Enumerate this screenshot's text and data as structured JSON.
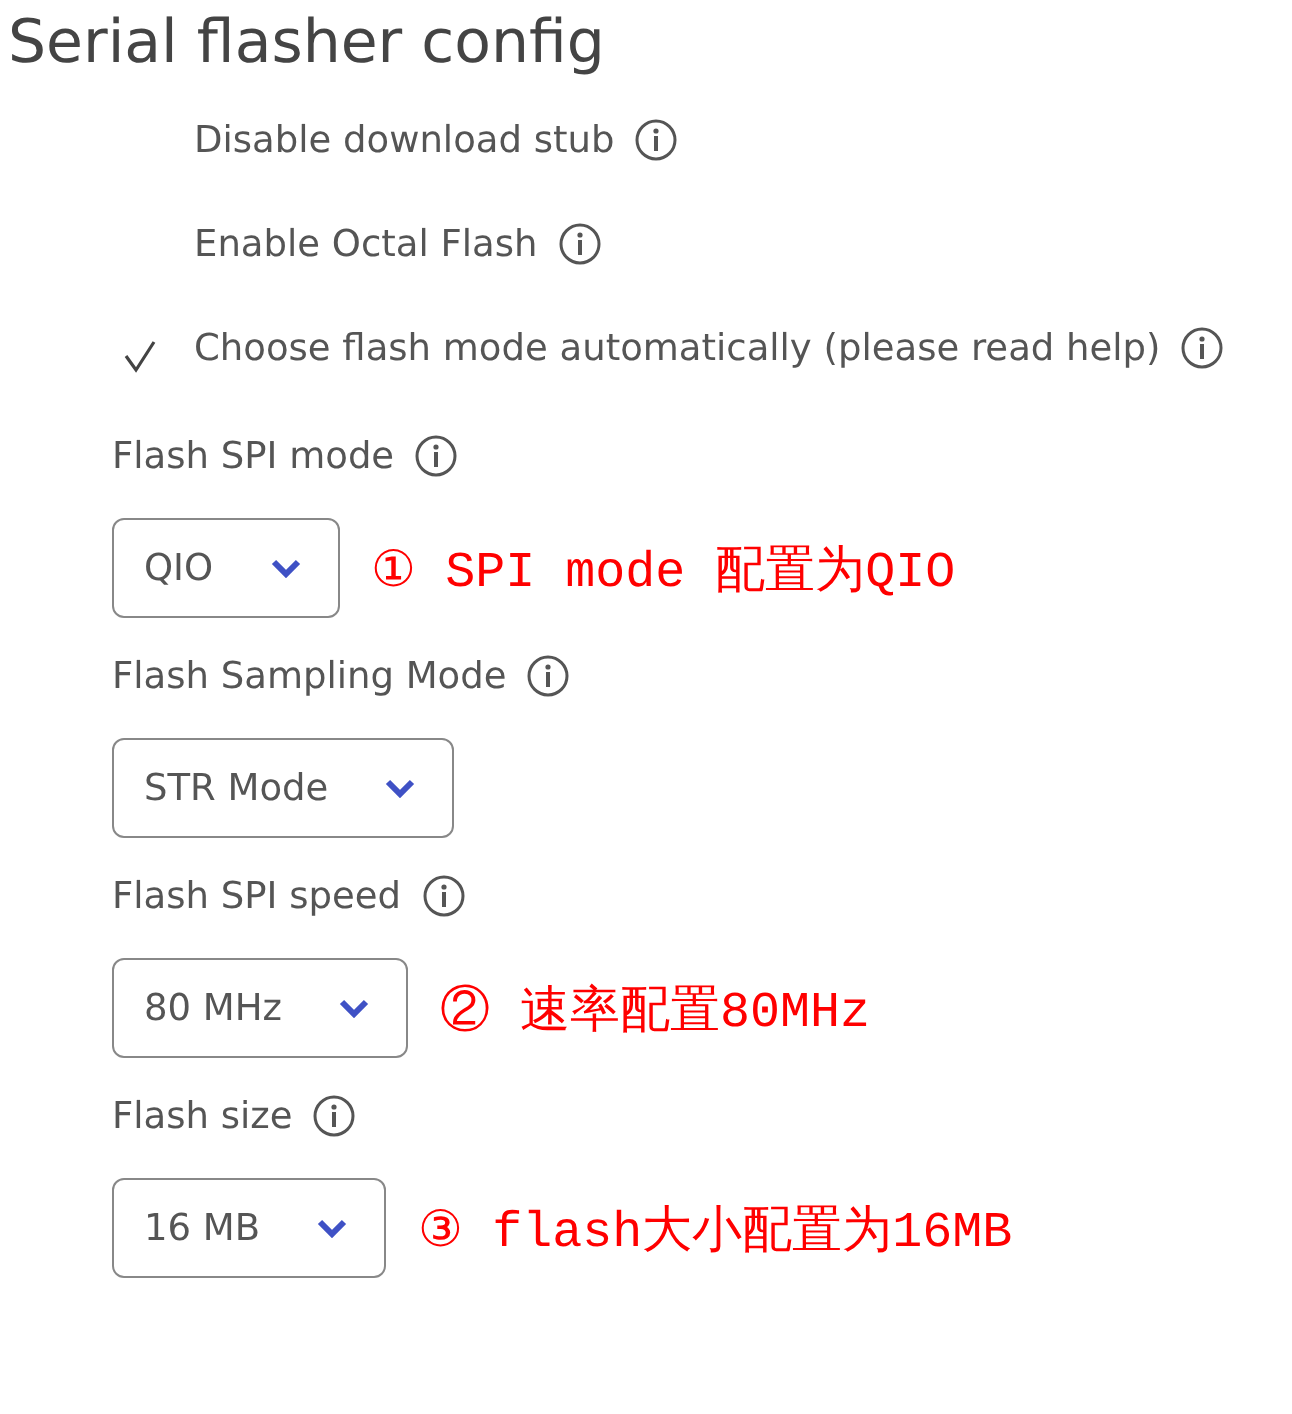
{
  "title": "Serial flasher config",
  "items": [
    {
      "kind": "checkbox",
      "label": "Disable download stub",
      "checked": false
    },
    {
      "kind": "checkbox",
      "label": "Enable Octal Flash",
      "checked": false
    },
    {
      "kind": "checkbox",
      "label": "Choose flash mode automatically (please read help)",
      "checked": true
    },
    {
      "kind": "select",
      "label": "Flash SPI mode",
      "value": "QIO",
      "annotation": "① SPI mode 配置为QIO"
    },
    {
      "kind": "select",
      "label": "Flash Sampling Mode",
      "value": "STR Mode"
    },
    {
      "kind": "select",
      "label": "Flash SPI speed",
      "value": "80 MHz",
      "annotation": "② 速率配置80MHz"
    },
    {
      "kind": "select",
      "label": "Flash size",
      "value": "16 MB",
      "annotation": "③ flash大小配置为16MB"
    }
  ]
}
